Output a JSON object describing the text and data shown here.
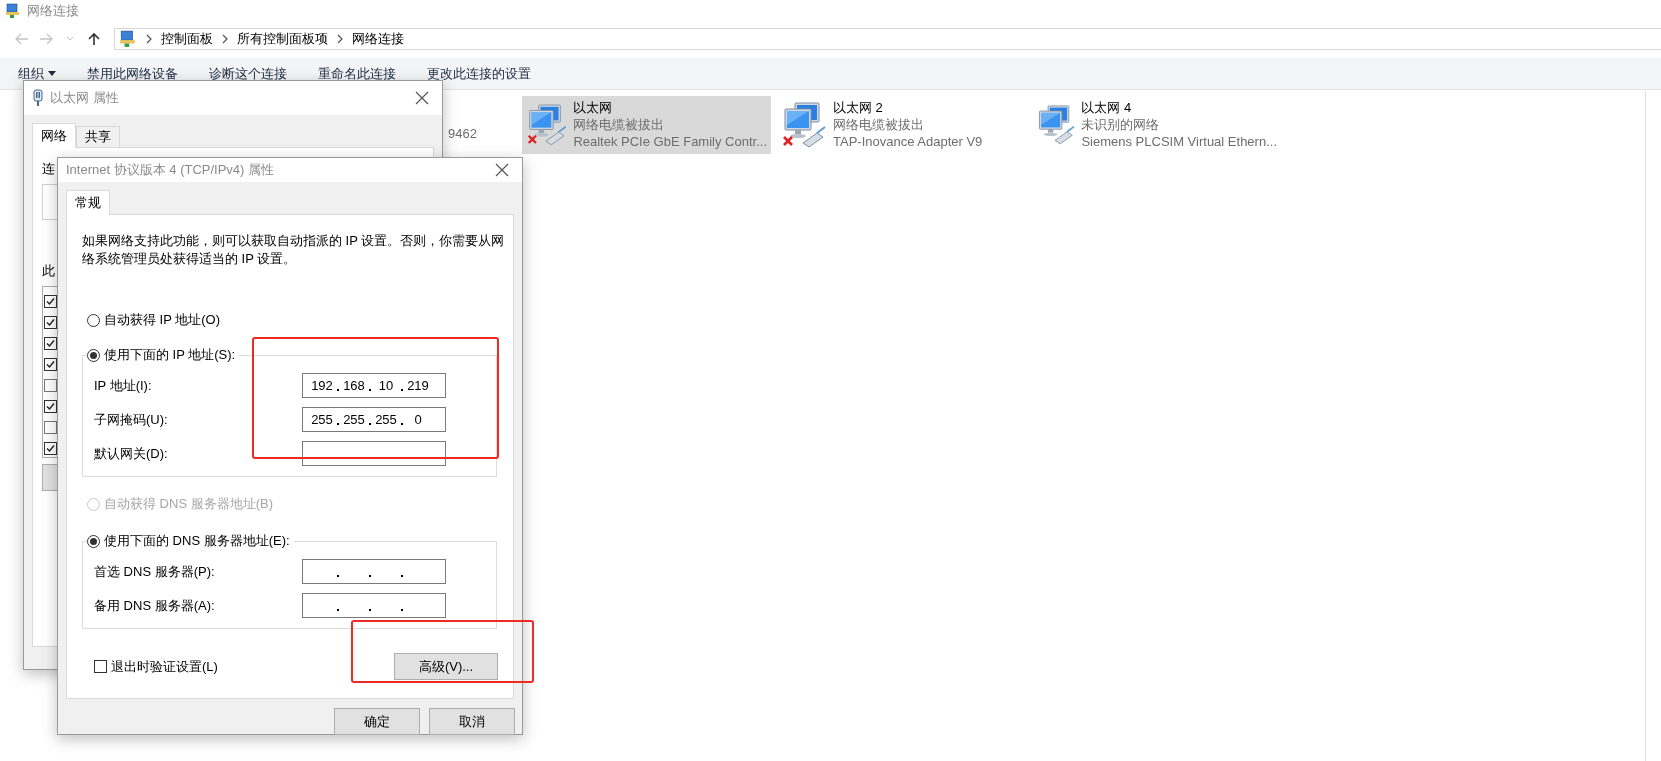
{
  "window": {
    "title": "网络连接"
  },
  "breadcrumb": [
    "控制面板",
    "所有控制面板项",
    "网络连接"
  ],
  "toolbar": [
    {
      "label": "组织",
      "kind": "menu"
    },
    {
      "label": "禁用此网络设备",
      "kind": "button"
    },
    {
      "label": "诊断这个连接",
      "kind": "button"
    },
    {
      "label": "重命名此连接",
      "kind": "button"
    },
    {
      "label": "更改此连接的设置",
      "kind": "button"
    }
  ],
  "hidden_adapter_text": "9462",
  "adapters": [
    {
      "name": "以太网",
      "status": "网络电缆被拔出",
      "device": "Realtek PCIe GbE Family Contr...",
      "selected": true,
      "disconnected": true
    },
    {
      "name": "以太网 2",
      "status": "网络电缆被拔出",
      "device": "TAP-Inovance Adapter V9",
      "selected": false,
      "disconnected": true
    },
    {
      "name": "以太网 4",
      "status": "未识别的网络",
      "device": "Siemens PLCSIM Virtual Ethern...",
      "selected": false,
      "disconnected": false
    }
  ],
  "ethernet_dialog": {
    "title": "以太网 属性",
    "tabs": [
      {
        "label": "网络",
        "selected": true
      },
      {
        "label": "共享",
        "selected": false
      }
    ],
    "labels": [
      "连",
      "此"
    ],
    "components": [
      {
        "checked": true
      },
      {
        "checked": true
      },
      {
        "checked": true
      },
      {
        "checked": true
      },
      {
        "checked": false
      },
      {
        "checked": true
      },
      {
        "checked": false
      },
      {
        "checked": true
      }
    ]
  },
  "ipv4_dialog": {
    "title": "Internet 协议版本 4 (TCP/IPv4) 属性",
    "tabs": [
      {
        "label": "常规",
        "selected": true
      }
    ],
    "description": "如果网络支持此功能，则可以获取自动指派的 IP 设置。否则，你需要从网络系统管理员处获得适当的 IP 设置。",
    "ip_auto": {
      "label": "自动获得 IP 地址(O)",
      "selected": false,
      "disabled": false
    },
    "ip_manual": {
      "label": "使用下面的 IP 地址(S):",
      "selected": true,
      "disabled": false
    },
    "ip_fields": [
      {
        "label": "IP 地址(I):",
        "octets": [
          "192",
          "168",
          "10",
          "219"
        ]
      },
      {
        "label": "子网掩码(U):",
        "octets": [
          "255",
          "255",
          "255",
          "0"
        ]
      },
      {
        "label": "默认网关(D):"
      }
    ],
    "dns_auto": {
      "label": "自动获得 DNS 服务器地址(B)",
      "selected": false,
      "disabled": true
    },
    "dns_manual": {
      "label": "使用下面的 DNS 服务器地址(E):",
      "selected": true,
      "disabled": false
    },
    "dns_fields": [
      {
        "label": "首选 DNS 服务器(P):"
      },
      {
        "label": "备用 DNS 服务器(A):"
      }
    ],
    "validate": {
      "label": "退出时验证设置(L)",
      "checked": false
    },
    "advanced_button": "高级(V)...",
    "buttons": [
      "确定",
      "取消"
    ]
  }
}
